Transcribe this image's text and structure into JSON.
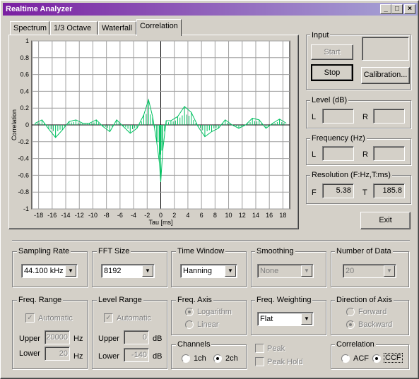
{
  "window": {
    "title": "Realtime Analyzer",
    "minimize": "_",
    "maximize": "□",
    "close": "×"
  },
  "tabs": [
    {
      "label": "Spectrum"
    },
    {
      "label": "1/3 Octave"
    },
    {
      "label": "Waterfall"
    },
    {
      "label": "Correlation"
    }
  ],
  "chart_data": {
    "type": "line",
    "xlabel": "Tau [ms]",
    "ylabel": "Correlation",
    "xlim": [
      -19,
      19
    ],
    "ylim": [
      -1,
      1
    ],
    "grid": true,
    "xticks": [
      -18,
      -16,
      -14,
      -12,
      -10,
      -8,
      -6,
      -4,
      -2,
      0,
      2,
      4,
      6,
      8,
      10,
      12,
      14,
      16,
      18
    ],
    "yticks": [
      -1,
      -0.8,
      -0.6,
      -0.4,
      -0.2,
      0,
      0.2,
      0.4,
      0.6,
      0.8,
      1
    ],
    "ytick_labels": [
      "-1",
      "-0.8",
      "-0.6",
      "-0.4",
      "-0.2",
      "0",
      "0.2",
      "0.4",
      "0.6",
      "0.8",
      "1"
    ],
    "series": [
      {
        "color": "#00c060",
        "x": [
          -18.5,
          -17.5,
          -16.5,
          -15.5,
          -14.5,
          -13.5,
          -12.5,
          -11.5,
          -10.5,
          -9.5,
          -8.5,
          -7.5,
          -6.5,
          -5.5,
          -4.5,
          -3.5,
          -2.5,
          -1.8,
          -1.2,
          -0.6,
          -0.2,
          0,
          0.3,
          0.8,
          1.5,
          2.5,
          3.5,
          4.5,
          5.5,
          6.5,
          7.5,
          8.5,
          9.5,
          10.5,
          11.5,
          12.5,
          13.5,
          14.5,
          15.5,
          16.5,
          17.5,
          18.5
        ],
        "y": [
          0.02,
          0.06,
          -0.05,
          -0.15,
          -0.06,
          0.04,
          0.06,
          0.02,
          0.02,
          0.06,
          -0.02,
          -0.08,
          0.06,
          -0.02,
          -0.1,
          -0.04,
          0.12,
          0.3,
          0.1,
          -0.2,
          -0.45,
          -0.68,
          -0.3,
          0.05,
          0.05,
          0.1,
          0.22,
          0.15,
          -0.02,
          -0.14,
          -0.08,
          -0.04,
          0.06,
          0.0,
          -0.04,
          0.0,
          0.08,
          0.06,
          -0.04,
          0.02,
          0.07,
          0.02
        ]
      }
    ]
  },
  "input": {
    "label": "Input",
    "start": "Start",
    "stop": "Stop",
    "calibration": "Calibration..."
  },
  "level": {
    "label": "Level (dB)",
    "l": "L",
    "r": "R",
    "l_value": "",
    "r_value": ""
  },
  "frequency": {
    "label": "Frequency (Hz)",
    "l": "L",
    "r": "R",
    "l_value": "",
    "r_value": ""
  },
  "resolution": {
    "label": "Resolution (F:Hz,T:ms)",
    "f": "F",
    "f_value": "5.38",
    "t": "T",
    "t_value": "185.8"
  },
  "exit": "Exit",
  "sampling_rate": {
    "label": "Sampling Rate",
    "value": "44.100 kHz"
  },
  "fft_size": {
    "label": "FFT Size",
    "value": "8192"
  },
  "time_window": {
    "label": "Time Window",
    "value": "Hanning"
  },
  "smoothing": {
    "label": "Smoothing",
    "value": "None"
  },
  "number_of_data": {
    "label": "Number of Data",
    "value": "20"
  },
  "freq_range": {
    "label": "Freq. Range",
    "automatic": "Automatic",
    "upper": "Upper",
    "upper_value": "20000",
    "upper_unit": "Hz",
    "lower": "Lower",
    "lower_value": "20",
    "lower_unit": "Hz"
  },
  "level_range": {
    "label": "Level Range",
    "automatic": "Automatic",
    "upper": "Upper",
    "upper_value": "0",
    "upper_unit": "dB",
    "lower": "Lower",
    "lower_value": "-140",
    "lower_unit": "dB"
  },
  "freq_axis": {
    "label": "Freq. Axis",
    "logarithm": "Logarithm",
    "linear": "Linear"
  },
  "freq_weighting": {
    "label": "Freq. Weighting",
    "value": "Flat"
  },
  "direction_of_axis": {
    "label": "Direction of Axis",
    "forward": "Forward",
    "backward": "Backward"
  },
  "channels": {
    "label": "Channels",
    "ch1": "1ch",
    "ch2": "2ch"
  },
  "peak": {
    "peak": "Peak",
    "peak_hold": "Peak Hold"
  },
  "correlation": {
    "label": "Correlation",
    "acf": "ACF",
    "ccf": "CCF"
  }
}
